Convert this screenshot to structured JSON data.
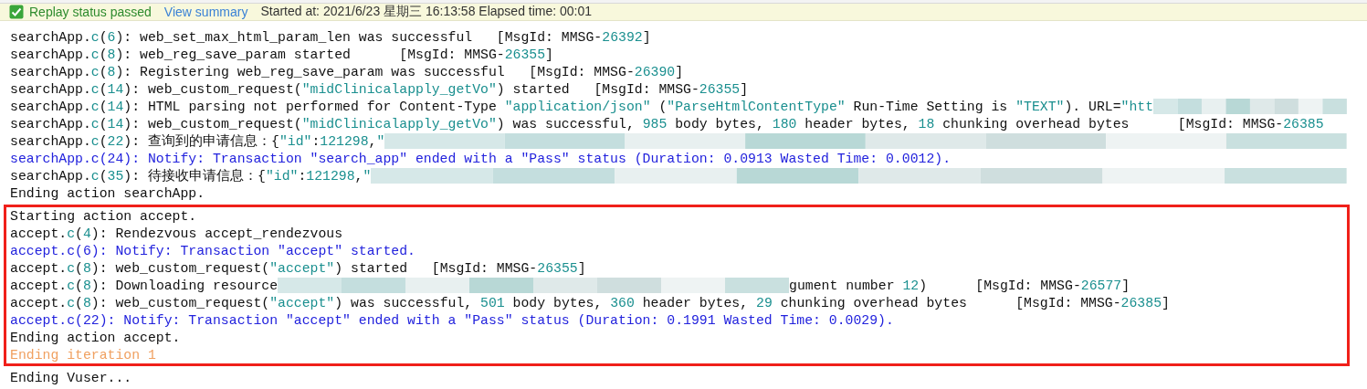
{
  "status_bar": {
    "passed": true,
    "status": "Replay status passed",
    "link": "View summary",
    "info": "Started at: 2021/6/23 星期三 16:13:58 Elapsed time: 00:01"
  },
  "log_sections": [
    {
      "highlighted": false,
      "lines": [
        {
          "kind": "info",
          "segments": [
            {
              "kind": "plain",
              "t": "searchApp."
            },
            {
              "kind": "num",
              "t": "c"
            },
            {
              "kind": "plain",
              "t": "("
            },
            {
              "kind": "num",
              "t": "6"
            },
            {
              "kind": "plain",
              "t": "): web_set_max_html_param_len was successful   [MsgId: MMSG-"
            },
            {
              "kind": "num",
              "t": "26392"
            },
            {
              "kind": "plain",
              "t": "]"
            }
          ]
        },
        {
          "kind": "info",
          "segments": [
            {
              "kind": "plain",
              "t": "searchApp."
            },
            {
              "kind": "num",
              "t": "c"
            },
            {
              "kind": "plain",
              "t": "("
            },
            {
              "kind": "num",
              "t": "8"
            },
            {
              "kind": "plain",
              "t": "): web_reg_save_param started      [MsgId: MMSG-"
            },
            {
              "kind": "num",
              "t": "26355"
            },
            {
              "kind": "plain",
              "t": "]"
            }
          ]
        },
        {
          "kind": "info",
          "segments": [
            {
              "kind": "plain",
              "t": "searchApp."
            },
            {
              "kind": "num",
              "t": "c"
            },
            {
              "kind": "plain",
              "t": "("
            },
            {
              "kind": "num",
              "t": "8"
            },
            {
              "kind": "plain",
              "t": "): Registering web_reg_save_param was successful   [MsgId: MMSG-"
            },
            {
              "kind": "num",
              "t": "26390"
            },
            {
              "kind": "plain",
              "t": "]"
            }
          ]
        },
        {
          "kind": "info",
          "segments": [
            {
              "kind": "plain",
              "t": "searchApp."
            },
            {
              "kind": "num",
              "t": "c"
            },
            {
              "kind": "plain",
              "t": "("
            },
            {
              "kind": "num",
              "t": "14"
            },
            {
              "kind": "plain",
              "t": "): web_custom_request("
            },
            {
              "kind": "num",
              "t": "\"midClinicalapply_getVo\""
            },
            {
              "kind": "plain",
              "t": ") started   [MsgId: MMSG-"
            },
            {
              "kind": "num",
              "t": "26355"
            },
            {
              "kind": "plain",
              "t": "]"
            }
          ]
        },
        {
          "kind": "info",
          "segments": [
            {
              "kind": "plain",
              "t": "searchApp."
            },
            {
              "kind": "num",
              "t": "c"
            },
            {
              "kind": "plain",
              "t": "("
            },
            {
              "kind": "num",
              "t": "14"
            },
            {
              "kind": "plain",
              "t": "): HTML parsing not performed for Content-Type "
            },
            {
              "kind": "num",
              "t": "\"application/json\""
            },
            {
              "kind": "plain",
              "t": " ("
            },
            {
              "kind": "num",
              "t": "\"ParseHtmlContentType\""
            },
            {
              "kind": "plain",
              "t": " Run-Time Setting is "
            },
            {
              "kind": "num",
              "t": "\"TEXT\""
            },
            {
              "kind": "plain",
              "t": "). URL="
            },
            {
              "kind": "num",
              "t": "\"htt"
            },
            {
              "kind": "redacted"
            }
          ]
        },
        {
          "kind": "info",
          "segments": [
            {
              "kind": "plain",
              "t": "searchApp."
            },
            {
              "kind": "num",
              "t": "c"
            },
            {
              "kind": "plain",
              "t": "("
            },
            {
              "kind": "num",
              "t": "14"
            },
            {
              "kind": "plain",
              "t": "): web_custom_request("
            },
            {
              "kind": "num",
              "t": "\"midClinicalapply_getVo\""
            },
            {
              "kind": "plain",
              "t": ") was successful, "
            },
            {
              "kind": "num",
              "t": "985"
            },
            {
              "kind": "plain",
              "t": " body bytes, "
            },
            {
              "kind": "num",
              "t": "180"
            },
            {
              "kind": "plain",
              "t": " header bytes, "
            },
            {
              "kind": "num",
              "t": "18"
            },
            {
              "kind": "plain",
              "t": " chunking overhead bytes      [MsgId: MMSG-"
            },
            {
              "kind": "num",
              "t": "26385"
            }
          ]
        },
        {
          "kind": "info",
          "segments": [
            {
              "kind": "plain",
              "t": "searchApp."
            },
            {
              "kind": "num",
              "t": "c"
            },
            {
              "kind": "plain",
              "t": "("
            },
            {
              "kind": "num",
              "t": "22"
            },
            {
              "kind": "plain",
              "t": "): 查询到的申请信息：{"
            },
            {
              "kind": "num",
              "t": "\"id\""
            },
            {
              "kind": "plain",
              "t": ":"
            },
            {
              "kind": "num",
              "t": "121298"
            },
            {
              "kind": "plain",
              "t": ","
            },
            {
              "kind": "num",
              "t": "\""
            },
            {
              "kind": "redacted"
            }
          ]
        },
        {
          "kind": "notify",
          "segments": [
            {
              "kind": "plain",
              "t": "searchApp.c(24): Notify: Transaction \"search_app\" ended with a \"Pass\" status (Duration: 0.0913 Wasted Time: 0.0012)."
            }
          ]
        },
        {
          "kind": "info",
          "segments": [
            {
              "kind": "plain",
              "t": "searchApp."
            },
            {
              "kind": "num",
              "t": "c"
            },
            {
              "kind": "plain",
              "t": "("
            },
            {
              "kind": "num",
              "t": "35"
            },
            {
              "kind": "plain",
              "t": "): 待接收申请信息：{"
            },
            {
              "kind": "num",
              "t": "\"id\""
            },
            {
              "kind": "plain",
              "t": ":"
            },
            {
              "kind": "num",
              "t": "121298"
            },
            {
              "kind": "plain",
              "t": ","
            },
            {
              "kind": "num",
              "t": "\""
            },
            {
              "kind": "redacted"
            }
          ]
        },
        {
          "kind": "info",
          "segments": [
            {
              "kind": "plain",
              "t": "Ending action searchApp."
            }
          ]
        }
      ]
    },
    {
      "highlighted": true,
      "lines": [
        {
          "kind": "info",
          "segments": [
            {
              "kind": "plain",
              "t": "Starting action accept."
            }
          ]
        },
        {
          "kind": "info",
          "segments": [
            {
              "kind": "plain",
              "t": "accept."
            },
            {
              "kind": "num",
              "t": "c"
            },
            {
              "kind": "plain",
              "t": "("
            },
            {
              "kind": "num",
              "t": "4"
            },
            {
              "kind": "plain",
              "t": "): Rendezvous accept_rendezvous"
            }
          ]
        },
        {
          "kind": "notify",
          "segments": [
            {
              "kind": "plain",
              "t": "accept.c(6): Notify: Transaction \"accept\" started."
            }
          ]
        },
        {
          "kind": "info",
          "segments": [
            {
              "kind": "plain",
              "t": "accept."
            },
            {
              "kind": "num",
              "t": "c"
            },
            {
              "kind": "plain",
              "t": "("
            },
            {
              "kind": "num",
              "t": "8"
            },
            {
              "kind": "plain",
              "t": "): web_custom_request("
            },
            {
              "kind": "num",
              "t": "\"accept\""
            },
            {
              "kind": "plain",
              "t": ") started   [MsgId: MMSG-"
            },
            {
              "kind": "num",
              "t": "26355"
            },
            {
              "kind": "plain",
              "t": "]"
            }
          ]
        },
        {
          "kind": "info",
          "segments": [
            {
              "kind": "plain",
              "t": "accept."
            },
            {
              "kind": "num",
              "t": "c"
            },
            {
              "kind": "plain",
              "t": "("
            },
            {
              "kind": "num",
              "t": "8"
            },
            {
              "kind": "plain",
              "t": "): Downloading resource"
            },
            {
              "kind": "redacted"
            },
            {
              "kind": "plain",
              "t": "gument number "
            },
            {
              "kind": "num",
              "t": "12"
            },
            {
              "kind": "plain",
              "t": ")      [MsgId: MMSG-"
            },
            {
              "kind": "num",
              "t": "26577"
            },
            {
              "kind": "plain",
              "t": "]"
            }
          ]
        },
        {
          "kind": "info",
          "segments": [
            {
              "kind": "plain",
              "t": "accept."
            },
            {
              "kind": "num",
              "t": "c"
            },
            {
              "kind": "plain",
              "t": "("
            },
            {
              "kind": "num",
              "t": "8"
            },
            {
              "kind": "plain",
              "t": "): web_custom_request("
            },
            {
              "kind": "num",
              "t": "\"accept\""
            },
            {
              "kind": "plain",
              "t": ") was successful, "
            },
            {
              "kind": "num",
              "t": "501"
            },
            {
              "kind": "plain",
              "t": " body bytes, "
            },
            {
              "kind": "num",
              "t": "360"
            },
            {
              "kind": "plain",
              "t": " header bytes, "
            },
            {
              "kind": "num",
              "t": "29"
            },
            {
              "kind": "plain",
              "t": " chunking overhead bytes      [MsgId: MMSG-"
            },
            {
              "kind": "num",
              "t": "26385"
            },
            {
              "kind": "plain",
              "t": "]"
            }
          ]
        },
        {
          "kind": "notify",
          "segments": [
            {
              "kind": "plain",
              "t": "accept.c(22): Notify: Transaction \"accept\" ended with a \"Pass\" status (Duration: 0.1991 Wasted Time: 0.0029)."
            }
          ]
        },
        {
          "kind": "info",
          "segments": [
            {
              "kind": "plain",
              "t": "Ending action accept."
            }
          ]
        },
        {
          "kind": "iteration",
          "segments": [
            {
              "kind": "plain",
              "t": "Ending iteration 1"
            }
          ]
        }
      ]
    },
    {
      "highlighted": false,
      "lines": [
        {
          "kind": "info",
          "segments": [
            {
              "kind": "plain",
              "t": "Ending Vuser..."
            }
          ]
        }
      ]
    }
  ]
}
